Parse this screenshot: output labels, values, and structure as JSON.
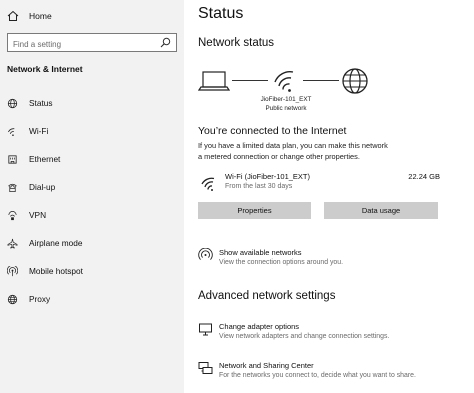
{
  "sidebar": {
    "home_label": "Home",
    "search_placeholder": "Find a setting",
    "section_title": "Network & Internet",
    "items": [
      {
        "label": "Status",
        "icon": "status-globe-icon"
      },
      {
        "label": "Wi-Fi",
        "icon": "wifi-icon"
      },
      {
        "label": "Ethernet",
        "icon": "ethernet-icon"
      },
      {
        "label": "Dial-up",
        "icon": "dialup-icon"
      },
      {
        "label": "VPN",
        "icon": "vpn-icon"
      },
      {
        "label": "Airplane mode",
        "icon": "airplane-icon"
      },
      {
        "label": "Mobile hotspot",
        "icon": "hotspot-icon"
      },
      {
        "label": "Proxy",
        "icon": "proxy-globe-icon"
      }
    ]
  },
  "main": {
    "title": "Status",
    "network_status_heading": "Network status",
    "network_name": "JioFiber-101_EXT",
    "network_type": "Public network",
    "connected_heading": "You’re connected to the Internet",
    "connected_desc": "If you have a limited data plan, you can make this network a metered connection or change other properties.",
    "connection": {
      "name": "Wi-Fi (JioFiber-101_EXT)",
      "sub": "From the last 30 days",
      "usage": "22.24 GB"
    },
    "buttons": {
      "properties": "Properties",
      "data_usage": "Data usage"
    },
    "show_networks": {
      "title": "Show available networks",
      "desc": "View the connection options around you."
    },
    "advanced_heading": "Advanced network settings",
    "change_adapter": {
      "title": "Change adapter options",
      "desc": "View network adapters and change connection settings."
    },
    "sharing_center": {
      "title": "Network and Sharing Center",
      "desc": "For the networks you connect to, decide what you want to share."
    }
  },
  "colors": {
    "sidebar_bg": "#f2f2f2",
    "button_bg": "#cccccc",
    "secondary_text": "#6a6a6a"
  }
}
